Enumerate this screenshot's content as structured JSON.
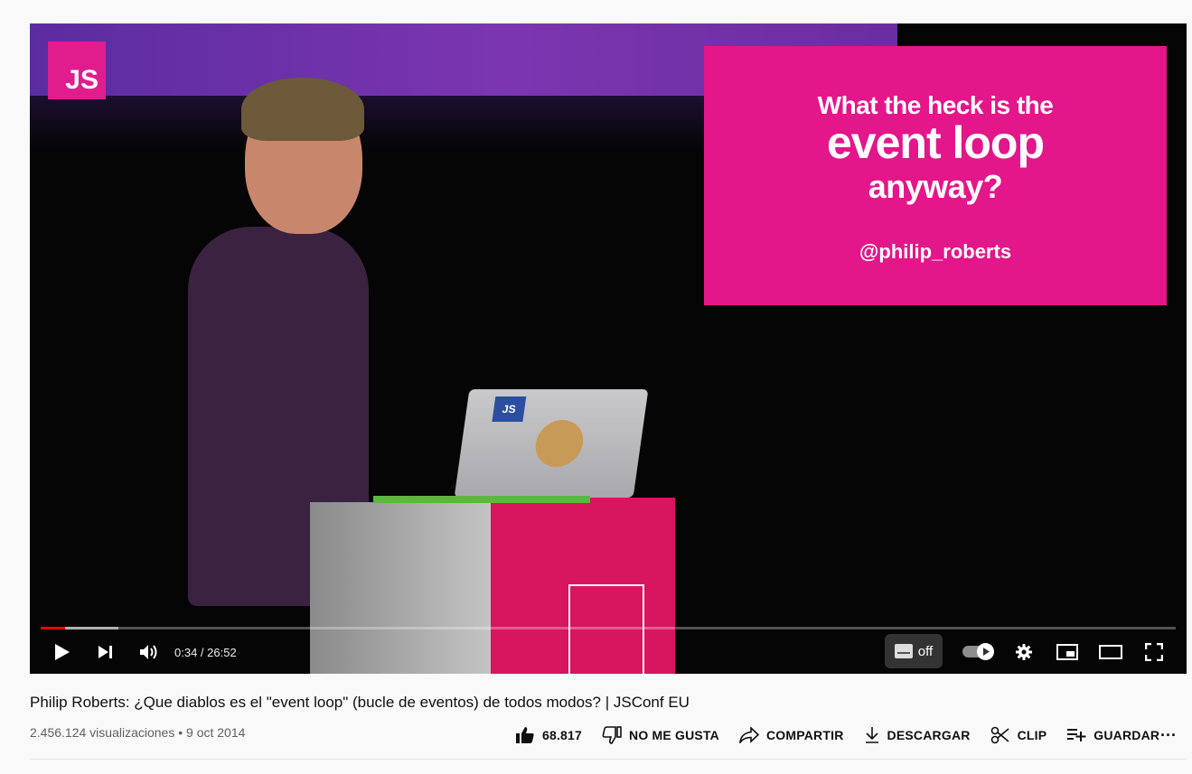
{
  "player": {
    "logo_text": "JS",
    "slide": {
      "line1": "What the heck is the",
      "line2": "event loop",
      "line3": "anyway?",
      "handle": "@philip_roberts"
    },
    "laptop_sticker": "JS",
    "time": "0:34 / 26:52",
    "progress_played": 0.0211,
    "progress_buffered": 0.0685,
    "captions_label": "off",
    "controls": {
      "play_icon": "play-icon",
      "next_icon": "next-icon",
      "volume_icon": "volume-icon",
      "autoplay_icon": "autoplay-toggle",
      "settings_icon": "gear-icon",
      "miniplayer_icon": "miniplayer-icon",
      "theater_icon": "theater-icon",
      "fullscreen_icon": "fullscreen-icon"
    }
  },
  "video": {
    "title": "Philip Roberts: ¿Que diablos es el \"event loop\" (bucle de eventos) de todos modos? | JSConf EU",
    "views": "2.456.124 visualizaciones",
    "separator": "•",
    "date": "9 oct 2014"
  },
  "actions": {
    "likes": "68.817",
    "dislike": "NO ME GUSTA",
    "share": "COMPARTIR",
    "download": "DESCARGAR",
    "clip": "CLIP",
    "save": "GUARDAR",
    "more": "···"
  }
}
